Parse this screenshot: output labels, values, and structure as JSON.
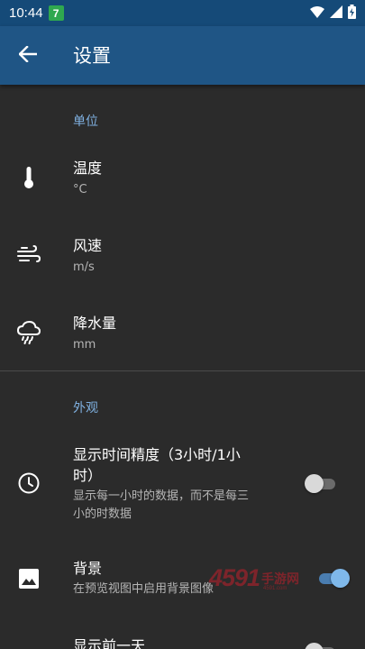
{
  "status_bar": {
    "time": "10:44",
    "app_badge": "7",
    "icons": [
      "wifi-icon",
      "signal-icon",
      "battery-charging-icon"
    ]
  },
  "app_bar": {
    "title": "设置",
    "back_icon": "arrow-back-icon"
  },
  "sections": {
    "units": {
      "header": "单位",
      "items": [
        {
          "title": "温度",
          "summary": "°C",
          "icon": "thermometer-icon"
        },
        {
          "title": "风速",
          "summary": "m/s",
          "icon": "wind-icon"
        },
        {
          "title": "降水量",
          "summary": "mm",
          "icon": "rain-cloud-icon"
        }
      ]
    },
    "appearance": {
      "header": "外观",
      "items": [
        {
          "title_line1": "显示时间精度（3小时/1小",
          "title_line2": "时）",
          "summary_line1": "显示每一小时的数据，而不是每三",
          "summary_line2": "小的时数据",
          "icon": "clock-icon",
          "switch_on": false
        },
        {
          "title": "背景",
          "summary": "在预览视图中启用背景图像",
          "icon": "image-icon",
          "switch_on": true
        },
        {
          "title": "显示前一天",
          "icon": "",
          "switch_on": false
        }
      ]
    }
  },
  "watermark": {
    "digits": "4591",
    "text": "手游网",
    "sub": "4591.com"
  },
  "colors": {
    "status_bar": "#154a78",
    "app_bar": "#1f5585",
    "background": "#2b2b2b",
    "section_header": "#7fb0e0",
    "switch_on_thumb": "#7fb8ea"
  }
}
